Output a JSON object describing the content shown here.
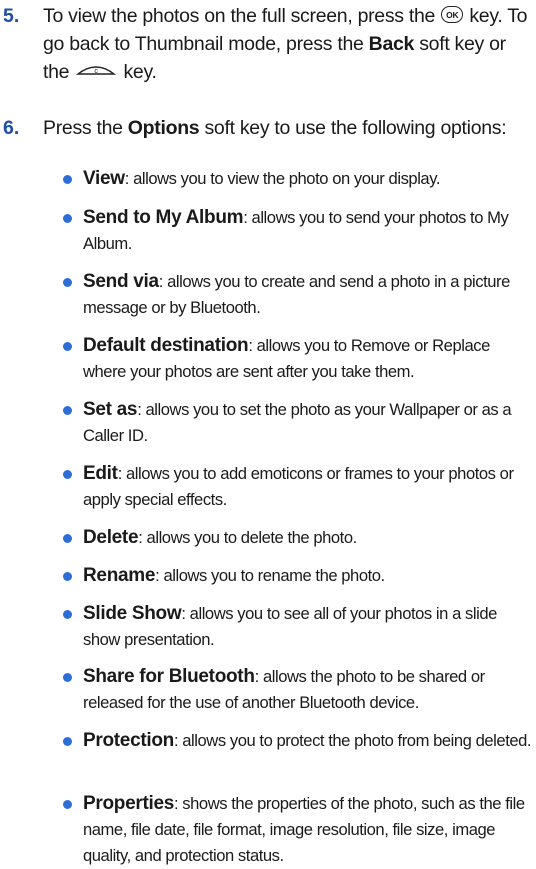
{
  "step5": {
    "number": "5.",
    "line1_pre": "To view the photos on the full screen, press the",
    "ok_key": "OK",
    "line1_post": "key. To go back to Thumbnail mode, press the",
    "back_bold": "Back",
    "line2_mid": "soft key or the",
    "line2_end": "key.",
    "back_key_icon": "back-key-icon"
  },
  "step6": {
    "number": "6.",
    "pre": "Press the",
    "options_bold": "Options",
    "post": "soft key to use the following options:"
  },
  "options": [
    {
      "term": "View",
      "desc": ": allows you to view the photo on your display."
    },
    {
      "term": "Send to My Album",
      "desc": ": allows you to send your photos to My Album."
    },
    {
      "term": "Send via",
      "desc": ": allows you to create and send a photo in a picture message or by Bluetooth."
    },
    {
      "term": "Default destination",
      "desc": ": allows you to Remove or Replace where your photos are sent after you take them."
    },
    {
      "term": "Set as",
      "desc": ": allows you to set the photo as your Wallpaper or as a Caller ID."
    },
    {
      "term": "Edit",
      "desc": ": allows you to add emoticons or frames to your photos or apply special effects."
    },
    {
      "term": "Delete",
      "desc": ": allows you to delete the photo."
    },
    {
      "term": "Rename",
      "desc": ": allows you to rename the photo."
    },
    {
      "term": "Slide Show",
      "desc": ": allows you to see all of your photos in a slide show presentation."
    },
    {
      "term": "Share for Bluetooth",
      "desc": ": allows the photo to be shared or released for the use of another Bluetooth device."
    },
    {
      "term": "Protection",
      "desc": ": allows you to protect the photo from being deleted."
    },
    {
      "term": "Properties",
      "desc": ": shows the properties of the photo, such as the file name, file date, file format, image resolution, file size, image quality, and protection status."
    }
  ],
  "colors": {
    "step_number": "#1f4ea8",
    "bullet": "#2b6fd6",
    "text": "#1a1a1a"
  }
}
